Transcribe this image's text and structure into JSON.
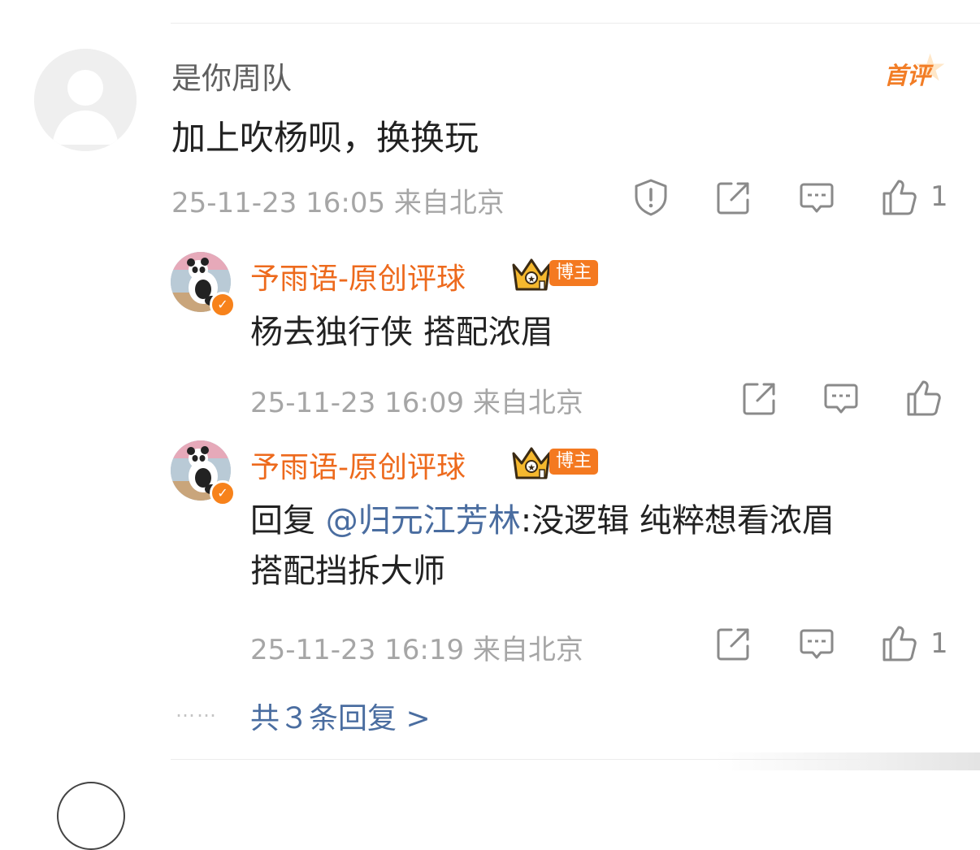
{
  "comment": {
    "author": "是你周队",
    "first_badge": "首评",
    "text": "加上吹杨呗，换换玩",
    "meta": "25-11-23 16:05 来自北京",
    "like_count": "1"
  },
  "replies": [
    {
      "author": "予雨语-原创评球",
      "badge": "博主",
      "text": "杨去独行侠 搭配浓眉",
      "meta": "25-11-23 16:09 来自北京",
      "like_count": ""
    },
    {
      "author": "予雨语-原创评球",
      "badge": "博主",
      "text_prefix": "回复 ",
      "mention": "@归元江芳林",
      "text_body": ":没逻辑 纯粹想看浓眉",
      "text_line2": "搭配挡拆大师",
      "meta": "25-11-23 16:19 来自北京",
      "like_count": "1"
    }
  ],
  "more": {
    "dots": "……",
    "label": "共３条回复 >"
  },
  "colors": {
    "accent_orange": "#ed6a1d",
    "link_blue": "#4a6da0",
    "meta_gray": "#a6a6a6"
  },
  "icons": [
    "report-icon",
    "repost-icon",
    "comment-icon",
    "like-icon",
    "verified-icon",
    "crown-icon",
    "panda-avatar"
  ]
}
